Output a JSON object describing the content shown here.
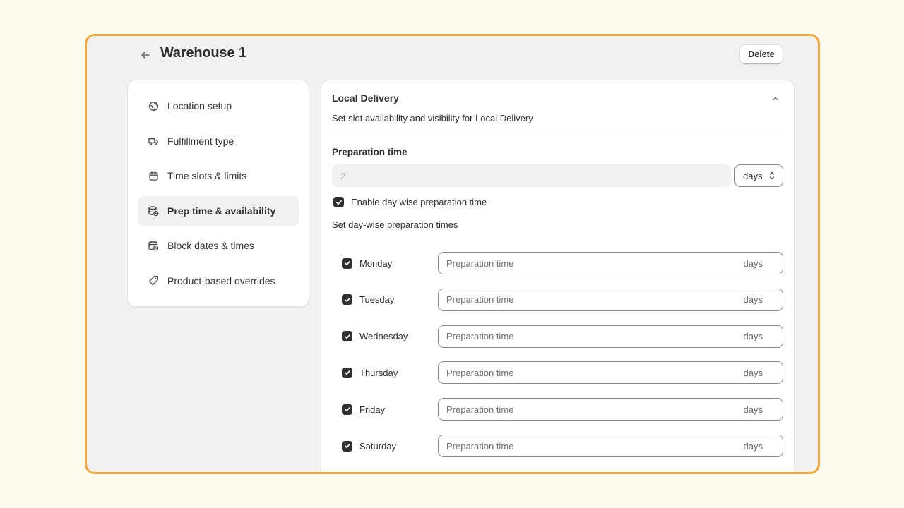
{
  "header": {
    "title": "Warehouse 1",
    "delete_label": "Delete"
  },
  "sidebar": {
    "items": [
      {
        "label": "Location setup",
        "icon": "globe-icon",
        "active": false
      },
      {
        "label": "Fulfillment type",
        "icon": "delivery-truck-icon",
        "active": false
      },
      {
        "label": "Time slots & limits",
        "icon": "calendar-icon",
        "active": false
      },
      {
        "label": "Prep time & availability",
        "icon": "database-clock-icon",
        "active": true
      },
      {
        "label": "Block dates & times",
        "icon": "calendar-clock-icon",
        "active": false
      },
      {
        "label": "Product-based overrides",
        "icon": "tag-icon",
        "active": false
      }
    ]
  },
  "card": {
    "title": "Local Delivery",
    "subtitle": "Set slot availability and visibility for Local Delivery",
    "prep_label": "Preparation time",
    "prep_value": "2",
    "unit": "days",
    "enable_label": "Enable day wise preparation time",
    "daywise_title": "Set day-wise preparation times",
    "day_placeholder": "Preparation time",
    "day_suffix": "days",
    "days": [
      "Monday",
      "Tuesday",
      "Wednesday",
      "Thursday",
      "Friday",
      "Saturday"
    ]
  },
  "colors": {
    "page_background": "#fdfbed",
    "frame_border": "#f4a73a",
    "app_background": "#f1f1f1",
    "checkbox": "#303030"
  }
}
